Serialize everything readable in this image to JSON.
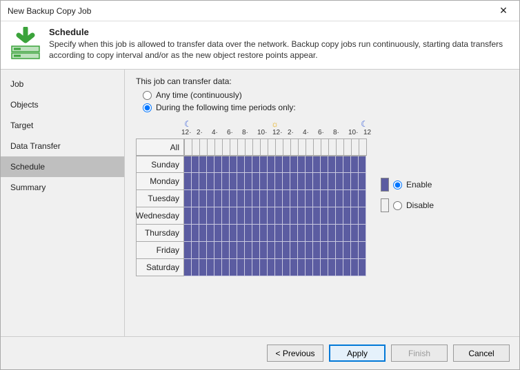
{
  "window_title": "New Backup Copy Job",
  "header": {
    "title": "Schedule",
    "description": "Specify when this job is allowed to transfer data over the network. Backup copy jobs run continuously, starting data transfers according to copy interval and/or as the new object restore points appear."
  },
  "sidebar": {
    "items": [
      {
        "label": "Job"
      },
      {
        "label": "Objects"
      },
      {
        "label": "Target"
      },
      {
        "label": "Data Transfer"
      },
      {
        "label": "Schedule"
      },
      {
        "label": "Summary"
      }
    ],
    "selected_index": 4
  },
  "content": {
    "prompt": "This job can transfer data:",
    "option_anytime": "Any time (continuously)",
    "option_periods": "During the following time periods only:",
    "selected_option": "periods",
    "time_ticks": [
      "12",
      "2",
      "4",
      "6",
      "8",
      "10",
      "12",
      "2",
      "4",
      "6",
      "8",
      "10",
      "12"
    ],
    "day_labels": [
      "All",
      "Sunday",
      "Monday",
      "Tuesday",
      "Wednesday",
      "Thursday",
      "Friday",
      "Saturday"
    ],
    "legend": {
      "enable": "Enable",
      "disable": "Disable",
      "selected": "enable"
    }
  },
  "footer": {
    "previous": "< Previous",
    "apply": "Apply",
    "finish": "Finish",
    "cancel": "Cancel"
  }
}
